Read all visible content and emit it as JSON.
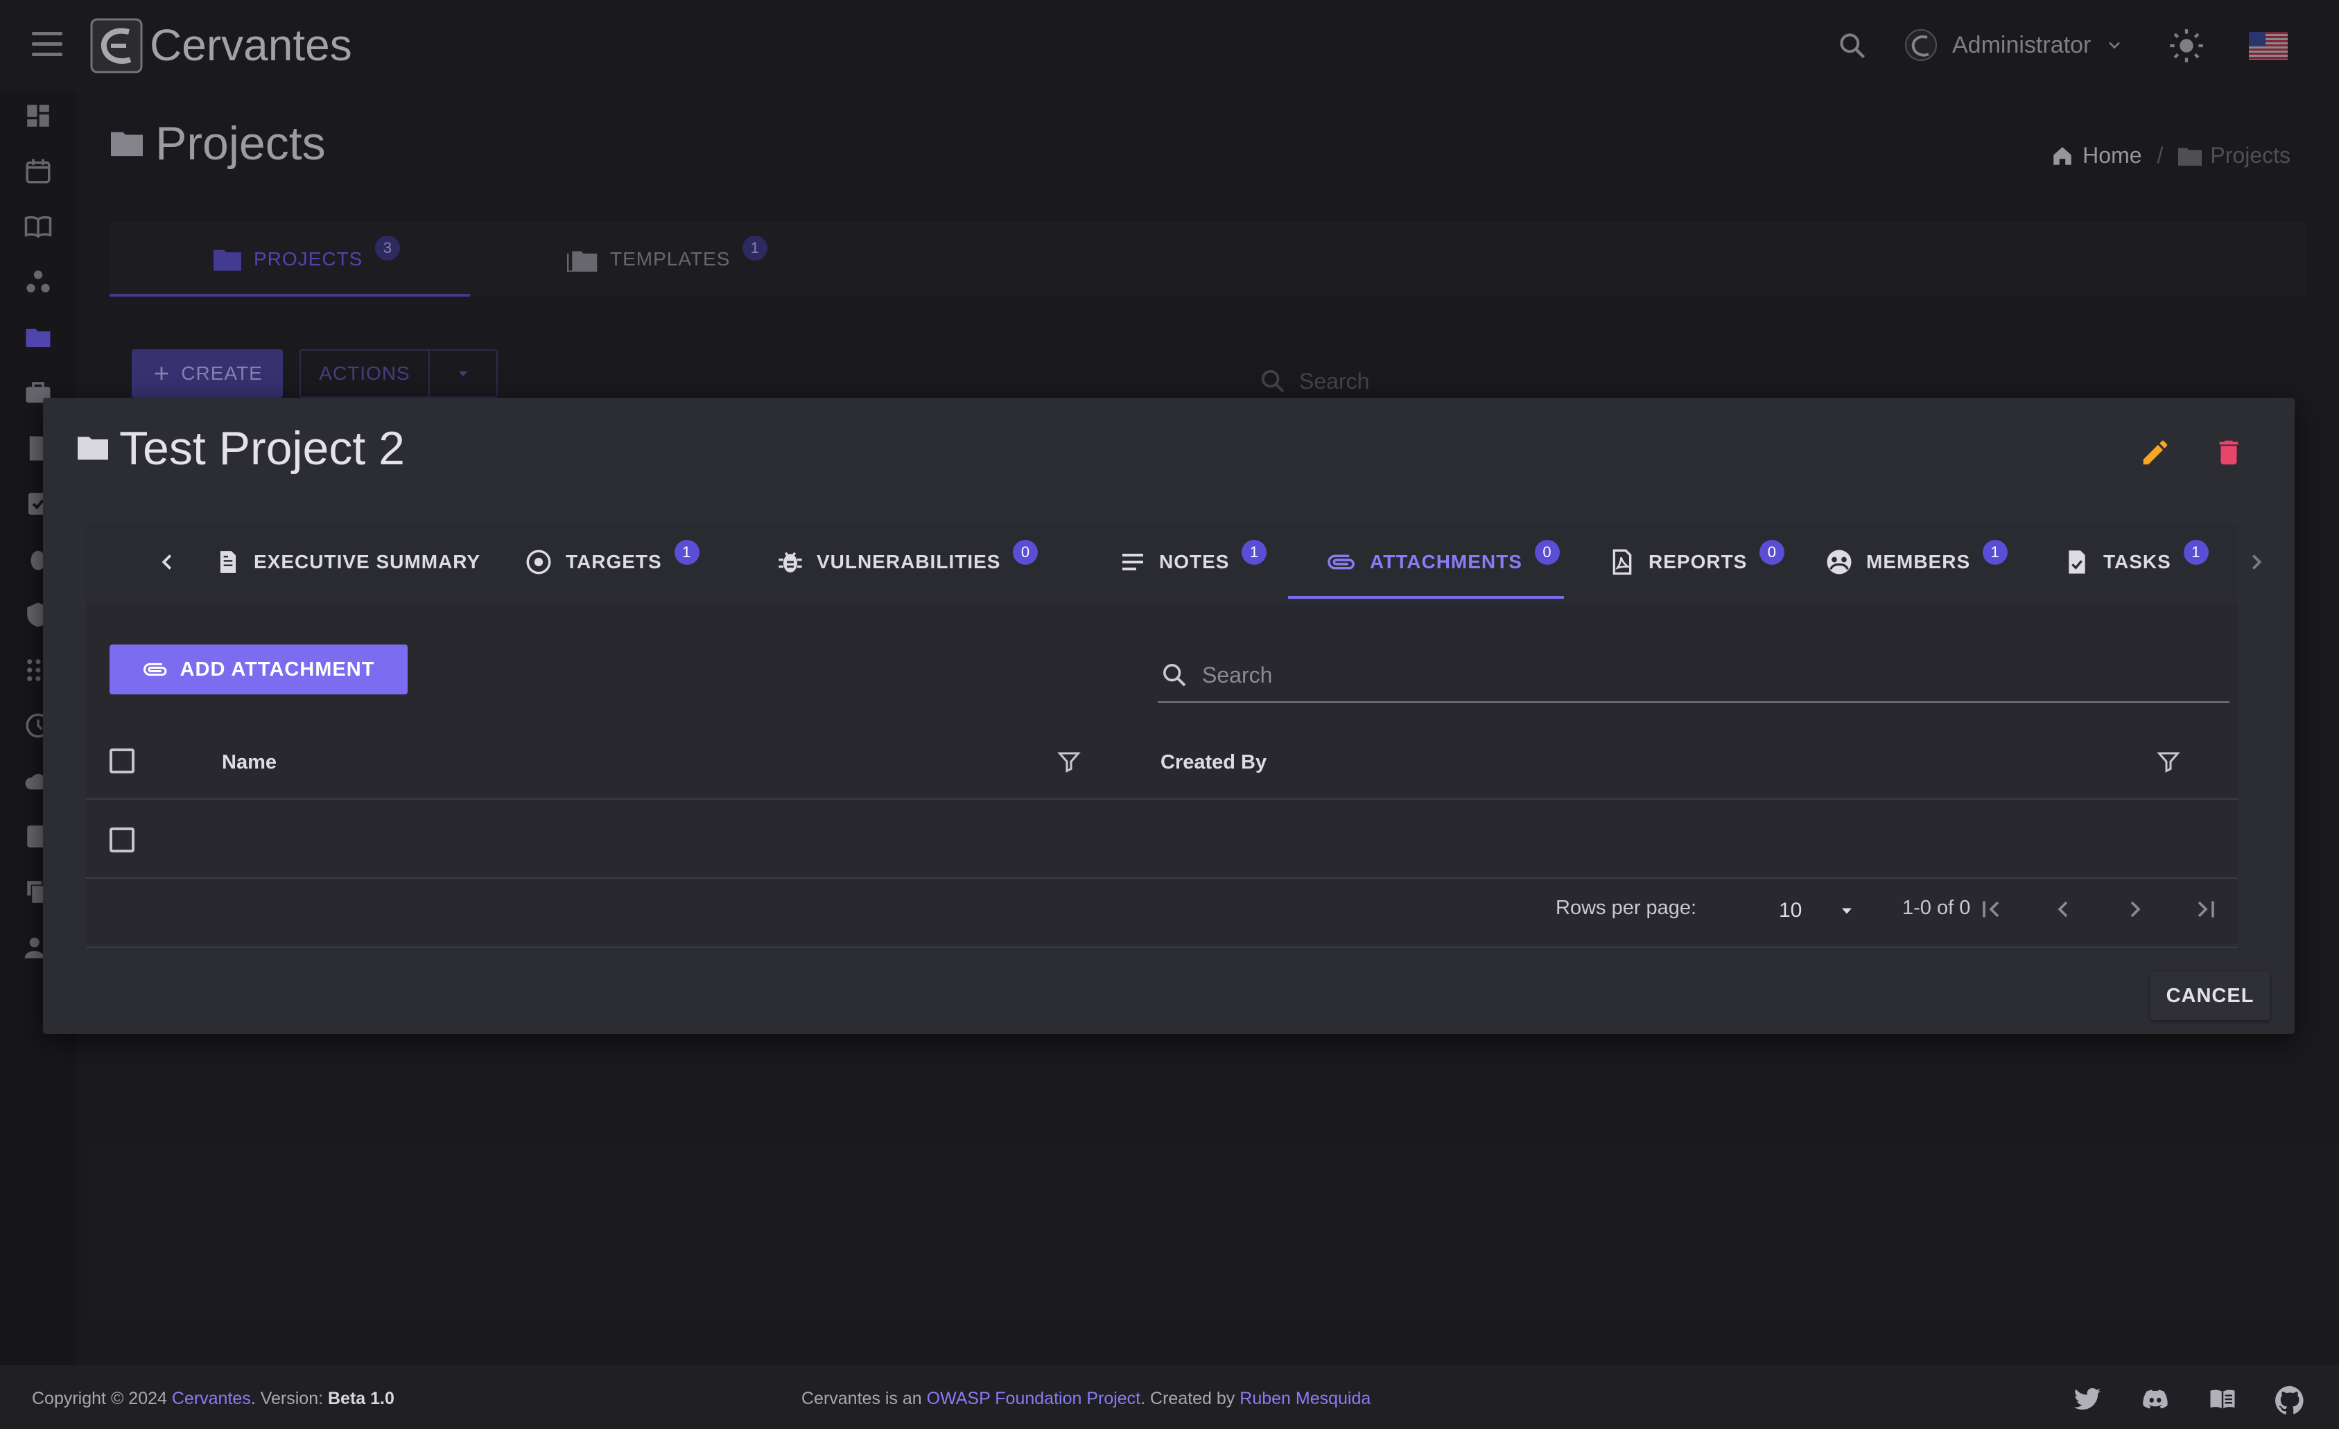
{
  "app": {
    "brand": "Cervantes"
  },
  "topbar": {
    "user_name": "Administrator"
  },
  "page": {
    "title": "Projects"
  },
  "breadcrumb": {
    "home": "Home",
    "current": "Projects"
  },
  "main_tabs": [
    {
      "label": "PROJECTS",
      "count": "3"
    },
    {
      "label": "TEMPLATES",
      "count": "1"
    }
  ],
  "toolbar": {
    "create_label": "CREATE",
    "actions_label": "ACTIONS",
    "search_placeholder": "Search"
  },
  "dialog": {
    "title": "Test Project 2",
    "tabs": [
      {
        "label": "EXECUTIVE SUMMARY",
        "count": ""
      },
      {
        "label": "TARGETS",
        "count": "1"
      },
      {
        "label": "VULNERABILITIES",
        "count": "0"
      },
      {
        "label": "NOTES",
        "count": "1"
      },
      {
        "label": "ATTACHMENTS",
        "count": "0"
      },
      {
        "label": "REPORTS",
        "count": "0"
      },
      {
        "label": "MEMBERS",
        "count": "1"
      },
      {
        "label": "TASKS",
        "count": "1"
      }
    ],
    "active_tab": "ATTACHMENTS",
    "add_button": "ADD ATTACHMENT",
    "search_placeholder": "Search",
    "table": {
      "columns": [
        "Name",
        "Created By"
      ],
      "rows": []
    },
    "pagination": {
      "rows_per_page_label": "Rows per page:",
      "rows_per_page": "10",
      "range": "1-0 of 0"
    },
    "cancel_label": "CANCEL"
  },
  "footer": {
    "copyright": "Copyright © 2024 ",
    "brand_link": "Cervantes",
    "version_prefix": ". Version: ",
    "version": "Beta 1.0",
    "owasp_prefix": "Cervantes is an ",
    "owasp_link": "OWASP Foundation Project",
    "created_by": ". Created by ",
    "author_link": "Ruben Mesquida"
  },
  "colors": {
    "accent": "#7b6cf0",
    "edit": "#f5a623",
    "delete": "#e8456b"
  }
}
